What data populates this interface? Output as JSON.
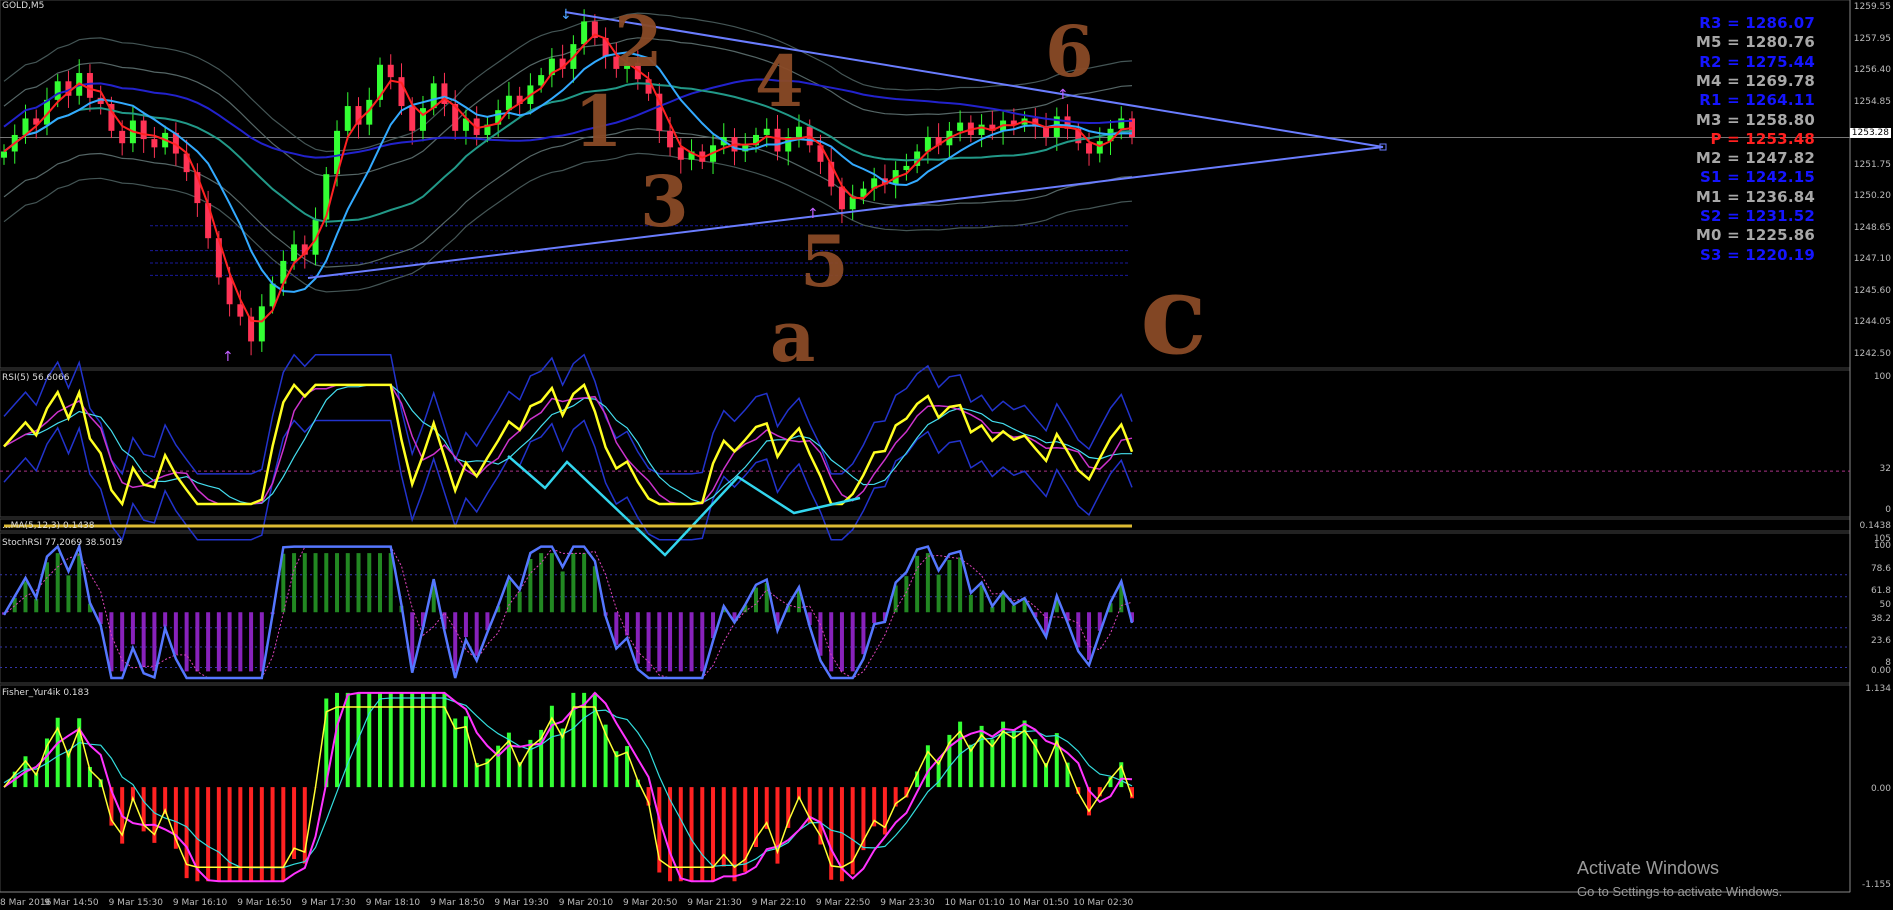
{
  "chart_data": {
    "type": "candlestick",
    "symbol_label": "GOLD,M5",
    "price_axis": [
      "1259.55",
      "1257.95",
      "1256.40",
      "1254.85",
      "1253.28",
      "1251.75",
      "1250.20",
      "1248.65",
      "1247.10",
      "1245.60",
      "1244.05",
      "1242.50"
    ],
    "current_price": "1253.28",
    "pivots": [
      {
        "label": "R3 = 1286.07",
        "color": "#1515ff"
      },
      {
        "label": "M5 = 1280.76",
        "color": "#a8a8a8"
      },
      {
        "label": "R2 = 1275.44",
        "color": "#1515ff"
      },
      {
        "label": "M4 = 1269.78",
        "color": "#a8a8a8"
      },
      {
        "label": "R1 = 1264.11",
        "color": "#1515ff"
      },
      {
        "label": "M3 = 1258.80",
        "color": "#a8a8a8"
      },
      {
        "label": "P  = 1253.48",
        "color": "#ff2020"
      },
      {
        "label": "M2 = 1247.82",
        "color": "#a8a8a8"
      },
      {
        "label": "S1 = 1242.15",
        "color": "#1515ff"
      },
      {
        "label": "M1 = 1236.84",
        "color": "#a8a8a8"
      },
      {
        "label": "S2 = 1231.52",
        "color": "#1515ff"
      },
      {
        "label": "M0 = 1225.86",
        "color": "#a8a8a8"
      },
      {
        "label": "S3 = 1220.19",
        "color": "#1515ff"
      }
    ],
    "wave_annotations": [
      "2",
      "4",
      "1",
      "3",
      "5",
      "6",
      "a",
      "c"
    ],
    "candles": [
      1252.6,
      1253.4,
      1254.2,
      1253.9,
      1255.1,
      1256.0,
      1255.3,
      1256.4,
      1255.2,
      1254.9,
      1253.6,
      1253.0,
      1254.1,
      1253.2,
      1252.8,
      1253.5,
      1252.5,
      1251.6,
      1250.1,
      1248.4,
      1246.5,
      1245.2,
      1244.6,
      1243.4,
      1245.1,
      1246.2,
      1247.3,
      1248.1,
      1247.6,
      1249.3,
      1251.5,
      1253.6,
      1254.8,
      1253.9,
      1255.1,
      1256.8,
      1256.2,
      1254.8,
      1253.6,
      1254.7,
      1255.9,
      1254.9,
      1253.6,
      1254.2,
      1253.4,
      1253.9,
      1254.6,
      1255.3,
      1254.9,
      1255.8,
      1256.3,
      1257.1,
      1256.6,
      1257.8,
      1258.9,
      1258.1,
      1257.2,
      1256.6,
      1256.9,
      1256.1,
      1255.4,
      1253.6,
      1252.8,
      1252.2,
      1252.6,
      1252.1,
      1252.9,
      1253.3,
      1252.6,
      1252.9,
      1253.4,
      1253.7,
      1252.6,
      1253.3,
      1253.8,
      1252.9,
      1252.1,
      1250.9,
      1249.8,
      1250.4,
      1250.8,
      1251.3,
      1251.0,
      1251.7,
      1251.9,
      1252.6,
      1253.3,
      1252.9,
      1253.6,
      1254.0,
      1253.4,
      1253.9,
      1253.6,
      1254.1,
      1253.9,
      1254.2,
      1253.8,
      1253.3,
      1254.3,
      1253.7,
      1253.0,
      1252.5,
      1253.1,
      1253.7,
      1254.2,
      1253.3
    ],
    "x_axis": [
      "8 Mar 2016",
      "9 Mar 14:50",
      "9 Mar 15:30",
      "9 Mar 16:10",
      "9 Mar 16:50",
      "9 Mar 17:30",
      "9 Mar 18:10",
      "9 Mar 18:50",
      "9 Mar 19:30",
      "9 Mar 20:10",
      "9 Mar 20:50",
      "9 Mar 21:30",
      "9 Mar 22:10",
      "9 Mar 22:50",
      "9 Mar 23:30",
      "10 Mar 01:10",
      "10 Mar 01:50",
      "10 Mar 02:30"
    ],
    "subcharts": [
      {
        "title": "RSI(5) 56.6066",
        "axis": [
          "100",
          "32",
          "0"
        ]
      },
      {
        "title": "...MA(5,12,3) 0.1438",
        "axis": [
          "0.1438"
        ]
      },
      {
        "title": "StochRSI 77.2069 38.5019",
        "axis": [
          "105",
          "100",
          "78.6",
          "61.8",
          "50",
          "38.2",
          "23.6",
          "8",
          "0.00"
        ]
      },
      {
        "title": "Fisher_Yur4ik 0.183",
        "axis": [
          "1.134",
          "0.00",
          "-1.155"
        ]
      }
    ]
  },
  "watermark": {
    "line1": "Activate Windows",
    "line2": "Go to Settings to activate Windows."
  }
}
